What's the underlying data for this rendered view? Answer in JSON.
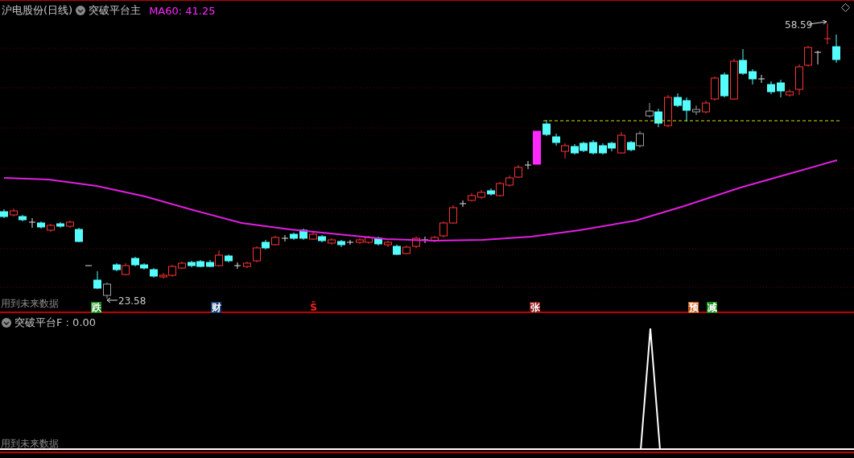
{
  "main_panel": {
    "stock_title": "沪电股份(日线)",
    "indicator_name": "突破平台主",
    "ma_reading": "MA60: 41.25",
    "high_label": "58.59",
    "low_label": "23.58",
    "future_note": "用到未来数据",
    "event_badges": [
      {
        "label": "跌",
        "color": "#148c14"
      },
      {
        "label": "财",
        "color": "#143c78"
      },
      {
        "label": "Ŝ",
        "kind": "symbol",
        "color": "#ff2020"
      },
      {
        "label": "张",
        "color": "#8c1414"
      },
      {
        "label": "预",
        "color": "#c85a14"
      },
      {
        "label": "减",
        "color": "#148c14"
      }
    ]
  },
  "sub_panel": {
    "title": "突破平台F : 0.00",
    "future_note": "用到未来数据"
  }
}
